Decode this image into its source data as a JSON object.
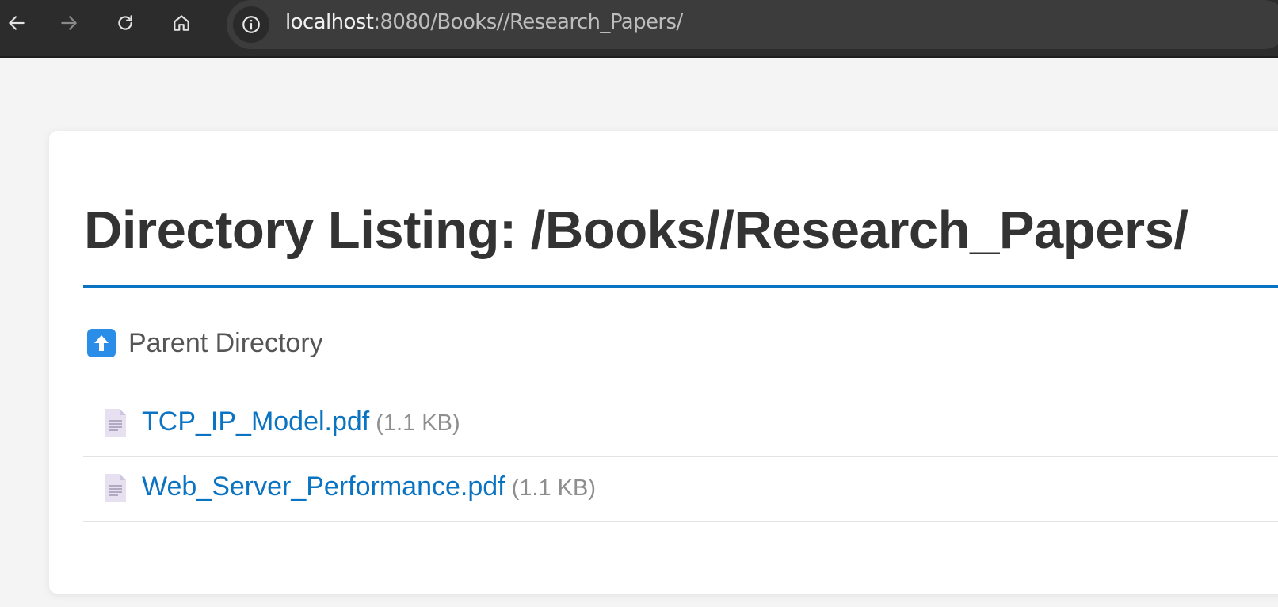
{
  "browser": {
    "url_host": "localhost",
    "url_path": ":8080/Books//Research_Papers/",
    "back_icon": "arrow-left-icon",
    "forward_icon": "arrow-right-icon",
    "reload_icon": "reload-icon",
    "home_icon": "home-icon",
    "site_info_icon": "info-icon"
  },
  "page": {
    "title": "Directory Listing: /Books//Research_Papers/",
    "parent_label": "Parent Directory",
    "parent_icon": "up-arrow-icon",
    "accent_color": "#0a73c2"
  },
  "files": [
    {
      "name": "TCP_IP_Model.pdf",
      "size": "(1.1 KB)",
      "icon": "document-icon"
    },
    {
      "name": "Web_Server_Performance.pdf",
      "size": "(1.1 KB)",
      "icon": "document-icon"
    }
  ]
}
